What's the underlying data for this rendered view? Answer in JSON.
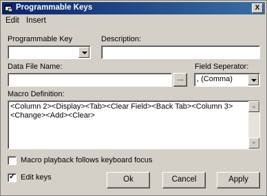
{
  "window": {
    "title": "Programmable Keys",
    "close_label": "X"
  },
  "menu": {
    "items": [
      "Edit",
      "Insert"
    ]
  },
  "form": {
    "programmable_key": {
      "label": "Programmable Key",
      "value": ""
    },
    "description": {
      "label": "Description:",
      "value": ""
    },
    "data_file": {
      "label": "Data File Name:",
      "value": "",
      "browse_label": "..."
    },
    "field_separator": {
      "label": "Field Seperator:",
      "value": ", (Comma)"
    },
    "macro": {
      "label": "Macro Definition:",
      "value": "<Column 2><Display><Tab><Clear Field><Back Tab><Column 3><Change><Add><Clear>"
    },
    "macro_playback": {
      "label": "Macro playback follows keyboard focus",
      "checked": false
    },
    "edit_keys": {
      "label": "Edit keys",
      "checked": true,
      "check_glyph": "✓"
    }
  },
  "buttons": {
    "ok": "Ok",
    "cancel": "Cancel",
    "apply": "Apply"
  },
  "icons": {
    "app_icon": "window-app-icon",
    "dropdown": "chevron-down-icon"
  },
  "colors": {
    "titlebar_start": "#0a246a",
    "titlebar_end": "#3a6ea5",
    "face": "#d4d0c8"
  }
}
